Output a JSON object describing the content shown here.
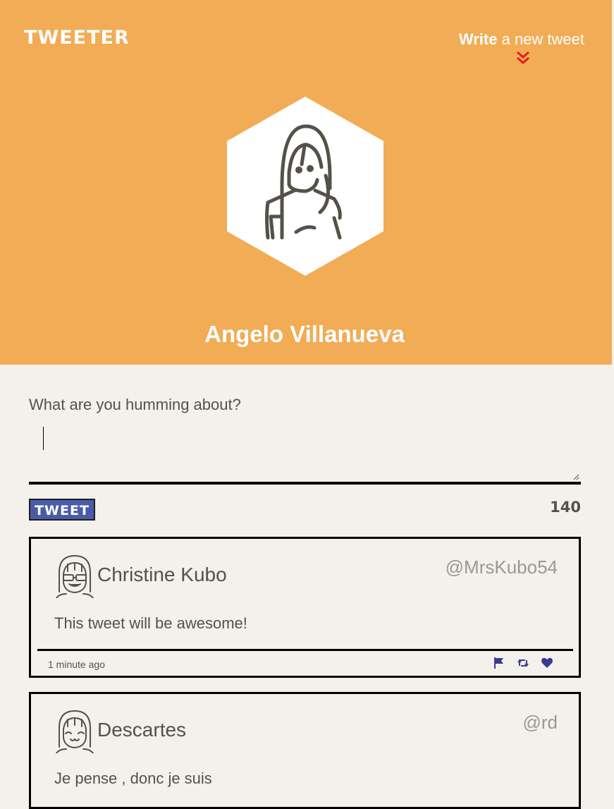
{
  "nav": {
    "brand": "TWEETER",
    "compose_bold": "Write",
    "compose_rest": " a new tweet"
  },
  "profile": {
    "name": "Angelo Villanueva"
  },
  "composer": {
    "prompt": "What are you humming about?",
    "value": "",
    "button_label": "TWEET",
    "counter": "140"
  },
  "tweets": [
    {
      "name": "Christine Kubo",
      "handle": "@MrsKubo54",
      "text": "This tweet will be awesome!",
      "time": "1 minute ago"
    },
    {
      "name": "Descartes",
      "handle": "@rd",
      "text": "Je pense , donc je suis",
      "time": ""
    }
  ],
  "colors": {
    "header_bg": "#f2ac55",
    "page_bg": "#f4f1ec",
    "accent": "#4a5ba6",
    "chevron": "#e0201b",
    "text": "#545149",
    "handle": "#9a9893"
  },
  "icons": {
    "compose": "chevron-double-down-icon",
    "flag": "flag-icon",
    "retweet": "retweet-icon",
    "like": "heart-icon"
  }
}
